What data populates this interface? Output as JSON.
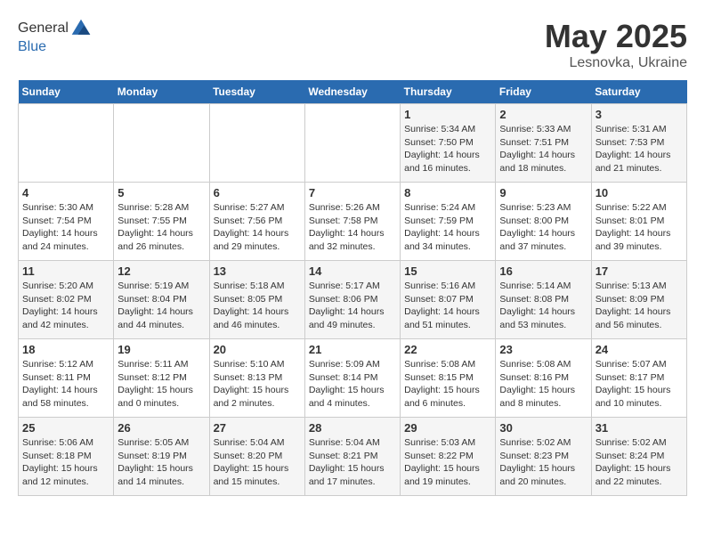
{
  "header": {
    "logo_general": "General",
    "logo_blue": "Blue",
    "title": "May 2025",
    "location": "Lesnovka, Ukraine"
  },
  "weekdays": [
    "Sunday",
    "Monday",
    "Tuesday",
    "Wednesday",
    "Thursday",
    "Friday",
    "Saturday"
  ],
  "weeks": [
    [
      {
        "day": "",
        "empty": true
      },
      {
        "day": "",
        "empty": true
      },
      {
        "day": "",
        "empty": true
      },
      {
        "day": "",
        "empty": true
      },
      {
        "day": "1",
        "sunrise": "5:34 AM",
        "sunset": "7:50 PM",
        "daylight": "14 hours and 16 minutes."
      },
      {
        "day": "2",
        "sunrise": "5:33 AM",
        "sunset": "7:51 PM",
        "daylight": "14 hours and 18 minutes."
      },
      {
        "day": "3",
        "sunrise": "5:31 AM",
        "sunset": "7:53 PM",
        "daylight": "14 hours and 21 minutes."
      }
    ],
    [
      {
        "day": "4",
        "sunrise": "5:30 AM",
        "sunset": "7:54 PM",
        "daylight": "14 hours and 24 minutes."
      },
      {
        "day": "5",
        "sunrise": "5:28 AM",
        "sunset": "7:55 PM",
        "daylight": "14 hours and 26 minutes."
      },
      {
        "day": "6",
        "sunrise": "5:27 AM",
        "sunset": "7:56 PM",
        "daylight": "14 hours and 29 minutes."
      },
      {
        "day": "7",
        "sunrise": "5:26 AM",
        "sunset": "7:58 PM",
        "daylight": "14 hours and 32 minutes."
      },
      {
        "day": "8",
        "sunrise": "5:24 AM",
        "sunset": "7:59 PM",
        "daylight": "14 hours and 34 minutes."
      },
      {
        "day": "9",
        "sunrise": "5:23 AM",
        "sunset": "8:00 PM",
        "daylight": "14 hours and 37 minutes."
      },
      {
        "day": "10",
        "sunrise": "5:22 AM",
        "sunset": "8:01 PM",
        "daylight": "14 hours and 39 minutes."
      }
    ],
    [
      {
        "day": "11",
        "sunrise": "5:20 AM",
        "sunset": "8:02 PM",
        "daylight": "14 hours and 42 minutes."
      },
      {
        "day": "12",
        "sunrise": "5:19 AM",
        "sunset": "8:04 PM",
        "daylight": "14 hours and 44 minutes."
      },
      {
        "day": "13",
        "sunrise": "5:18 AM",
        "sunset": "8:05 PM",
        "daylight": "14 hours and 46 minutes."
      },
      {
        "day": "14",
        "sunrise": "5:17 AM",
        "sunset": "8:06 PM",
        "daylight": "14 hours and 49 minutes."
      },
      {
        "day": "15",
        "sunrise": "5:16 AM",
        "sunset": "8:07 PM",
        "daylight": "14 hours and 51 minutes."
      },
      {
        "day": "16",
        "sunrise": "5:14 AM",
        "sunset": "8:08 PM",
        "daylight": "14 hours and 53 minutes."
      },
      {
        "day": "17",
        "sunrise": "5:13 AM",
        "sunset": "8:09 PM",
        "daylight": "14 hours and 56 minutes."
      }
    ],
    [
      {
        "day": "18",
        "sunrise": "5:12 AM",
        "sunset": "8:11 PM",
        "daylight": "14 hours and 58 minutes."
      },
      {
        "day": "19",
        "sunrise": "5:11 AM",
        "sunset": "8:12 PM",
        "daylight": "15 hours and 0 minutes."
      },
      {
        "day": "20",
        "sunrise": "5:10 AM",
        "sunset": "8:13 PM",
        "daylight": "15 hours and 2 minutes."
      },
      {
        "day": "21",
        "sunrise": "5:09 AM",
        "sunset": "8:14 PM",
        "daylight": "15 hours and 4 minutes."
      },
      {
        "day": "22",
        "sunrise": "5:08 AM",
        "sunset": "8:15 PM",
        "daylight": "15 hours and 6 minutes."
      },
      {
        "day": "23",
        "sunrise": "5:08 AM",
        "sunset": "8:16 PM",
        "daylight": "15 hours and 8 minutes."
      },
      {
        "day": "24",
        "sunrise": "5:07 AM",
        "sunset": "8:17 PM",
        "daylight": "15 hours and 10 minutes."
      }
    ],
    [
      {
        "day": "25",
        "sunrise": "5:06 AM",
        "sunset": "8:18 PM",
        "daylight": "15 hours and 12 minutes."
      },
      {
        "day": "26",
        "sunrise": "5:05 AM",
        "sunset": "8:19 PM",
        "daylight": "15 hours and 14 minutes."
      },
      {
        "day": "27",
        "sunrise": "5:04 AM",
        "sunset": "8:20 PM",
        "daylight": "15 hours and 15 minutes."
      },
      {
        "day": "28",
        "sunrise": "5:04 AM",
        "sunset": "8:21 PM",
        "daylight": "15 hours and 17 minutes."
      },
      {
        "day": "29",
        "sunrise": "5:03 AM",
        "sunset": "8:22 PM",
        "daylight": "15 hours and 19 minutes."
      },
      {
        "day": "30",
        "sunrise": "5:02 AM",
        "sunset": "8:23 PM",
        "daylight": "15 hours and 20 minutes."
      },
      {
        "day": "31",
        "sunrise": "5:02 AM",
        "sunset": "8:24 PM",
        "daylight": "15 hours and 22 minutes."
      }
    ]
  ],
  "labels": {
    "sunrise": "Sunrise:",
    "sunset": "Sunset:",
    "daylight": "Daylight hours"
  }
}
